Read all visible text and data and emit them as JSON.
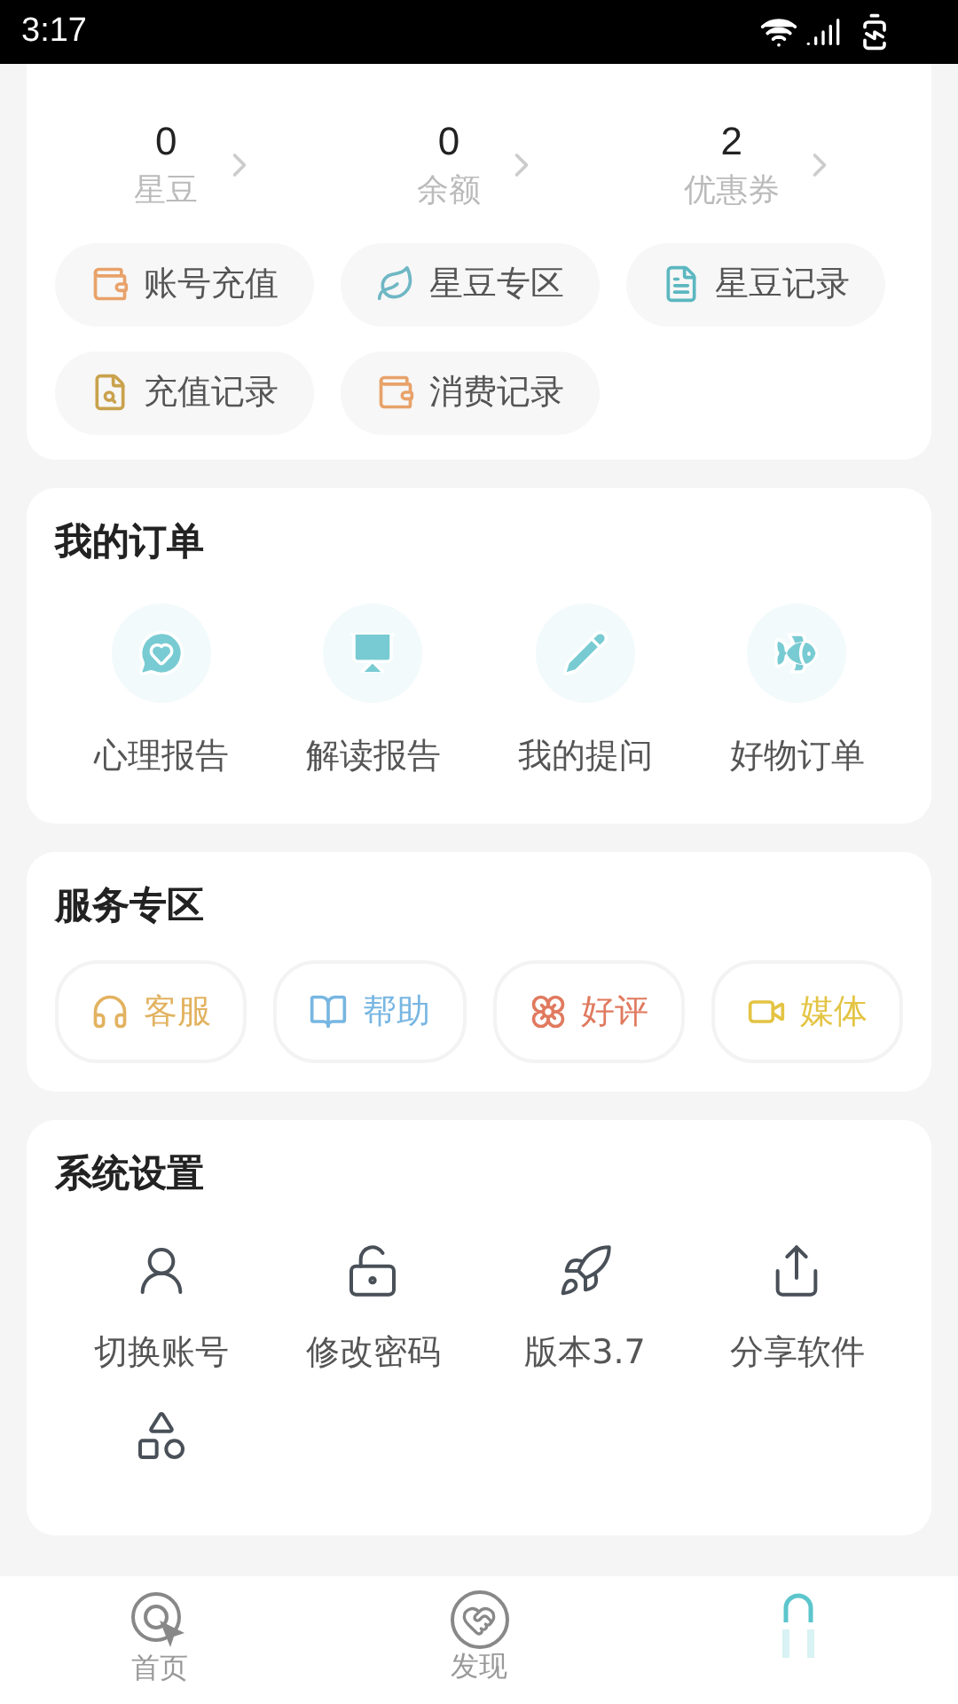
{
  "status_bar": {
    "time": "3:17"
  },
  "account": {
    "stats": [
      {
        "value": "0",
        "label": "星豆"
      },
      {
        "value": "0",
        "label": "余额"
      },
      {
        "value": "2",
        "label": "优惠券"
      }
    ],
    "actions": [
      "账号充值",
      "星豆专区",
      "星豆记录",
      "充值记录",
      "消费记录"
    ]
  },
  "orders": {
    "title": "我的订单",
    "items": [
      "心理报告",
      "解读报告",
      "我的提问",
      "好物订单"
    ]
  },
  "services": {
    "title": "服务专区",
    "items": [
      {
        "label": "客服",
        "color": "#e2b260"
      },
      {
        "label": "帮助",
        "color": "#78b6e2"
      },
      {
        "label": "好评",
        "color": "#e07a5f"
      },
      {
        "label": "媒体",
        "color": "#e3c443"
      }
    ]
  },
  "settings": {
    "title": "系统设置",
    "items": [
      "切换账号",
      "修改密码",
      "版本3.7",
      "分享软件"
    ]
  },
  "tabs": [
    {
      "label": "首页",
      "selected": false
    },
    {
      "label": "发现",
      "selected": false
    },
    {
      "selected": true
    }
  ]
}
